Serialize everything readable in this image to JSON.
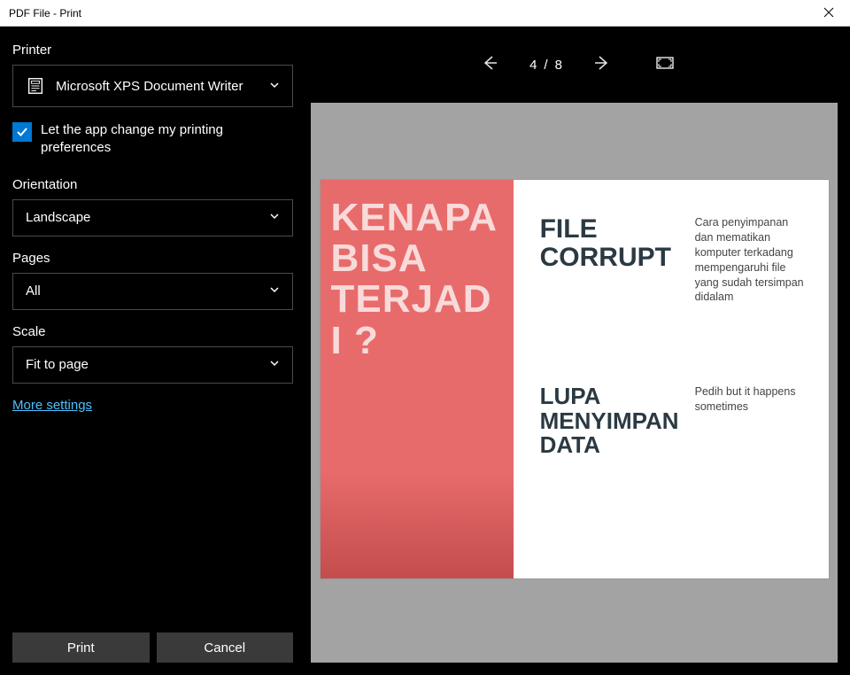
{
  "window": {
    "title": "PDF File - Print"
  },
  "printer": {
    "label": "Printer",
    "selected": "Microsoft XPS Document Writer"
  },
  "pref_checkbox": {
    "label": "Let the app change my printing preferences",
    "checked": true
  },
  "orientation": {
    "label": "Orientation",
    "selected": "Landscape"
  },
  "pages": {
    "label": "Pages",
    "selected": "All"
  },
  "scale": {
    "label": "Scale",
    "selected": "Fit to page"
  },
  "more_settings": "More settings",
  "buttons": {
    "print": "Print",
    "cancel": "Cancel"
  },
  "preview": {
    "current_page": "4",
    "sep": "/",
    "total_pages": "8"
  },
  "doc": {
    "left_text": "KENAPA BISA TERJADI ?",
    "block1": {
      "title": "FILE CORRUPT",
      "desc": "Cara penyimpanan dan mematikan komputer terkadang mempengaruhi file yang sudah tersimpan didalam"
    },
    "block2": {
      "title": "LUPA MENYIMPAN DATA",
      "desc": "Pedih but it happens sometimes"
    }
  }
}
